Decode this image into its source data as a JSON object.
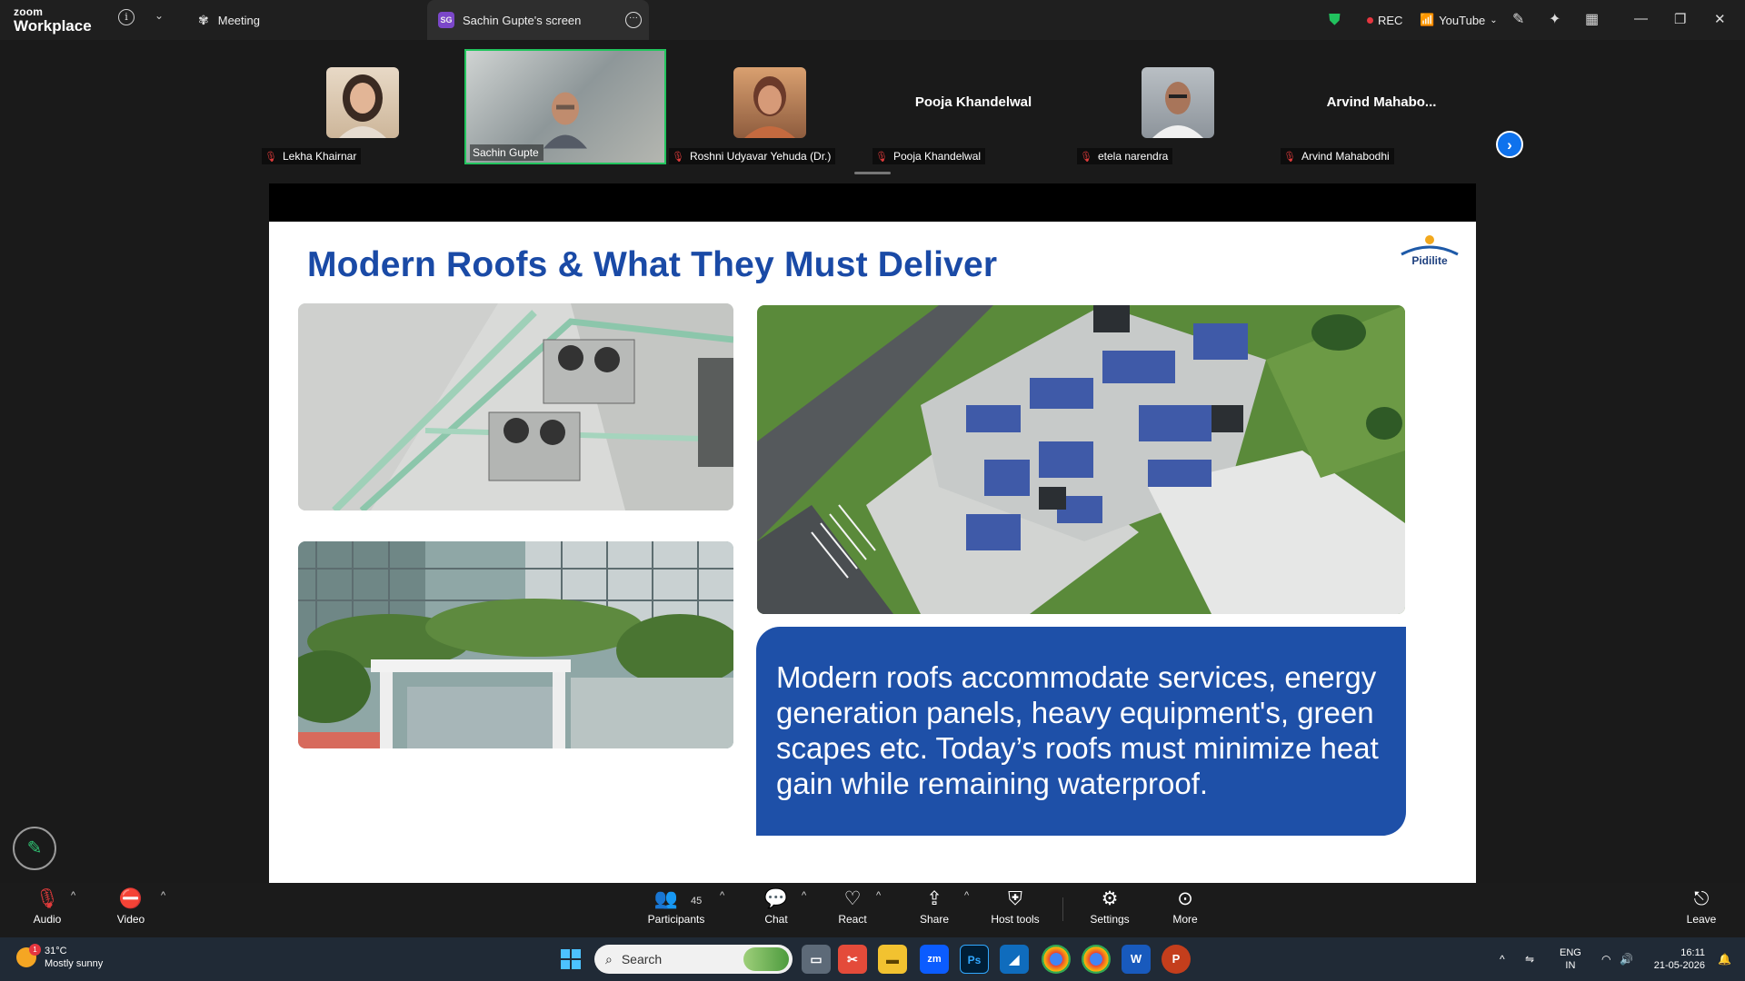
{
  "app": {
    "brand_top": "zoom",
    "brand_bottom": "Workplace"
  },
  "titlebar": {
    "meeting_tab": "Meeting",
    "screen_tab_initials": "SG",
    "screen_tab": "Sachin Gupte's screen",
    "rec_label": "REC",
    "stream_label": "YouTube"
  },
  "gallery": {
    "tiles": [
      {
        "name": "Lekha Khairnar"
      },
      {
        "name": "Sachin Gupte"
      },
      {
        "name": "Roshni Udyavar Yehuda (Dr.)"
      },
      {
        "name": "Pooja Khandelwal",
        "display": "Pooja Khandelwal"
      },
      {
        "name": "etela narendra"
      },
      {
        "name": "Arvind Mahabodhi",
        "display": "Arvind  Mahabo..."
      }
    ]
  },
  "slide": {
    "title": "Modern Roofs & What They Must Deliver",
    "logo_text": "Pidilite",
    "callout": "Modern roofs accommodate services, energy generation panels, heavy equipment's, green scapes etc. Today’s roofs must minimize heat gain while remaining waterproof."
  },
  "toolbar": {
    "audio": "Audio",
    "video": "Video",
    "participants": "Participants",
    "participant_count": "45",
    "chat": "Chat",
    "react": "React",
    "share": "Share",
    "host_tools": "Host tools",
    "settings": "Settings",
    "more": "More",
    "leave": "Leave"
  },
  "taskbar": {
    "weather_temp": "31°C",
    "weather_desc": "Mostly sunny",
    "weather_badge": "1",
    "search_placeholder": "Search",
    "lang_top": "ENG",
    "lang_bottom": "IN",
    "time": "16:11",
    "date": "21-05-2026"
  },
  "colors": {
    "zoom_blue": "#0e72ed",
    "active_speaker": "#22c55e",
    "slide_title": "#1a4aa6",
    "callout_bg": "#1e50a8",
    "rec_red": "#e5363f"
  },
  "icons": {
    "annotate": "pencil-icon",
    "mic_muted": "mic-off-icon",
    "next_page": "chevron-right-icon"
  }
}
